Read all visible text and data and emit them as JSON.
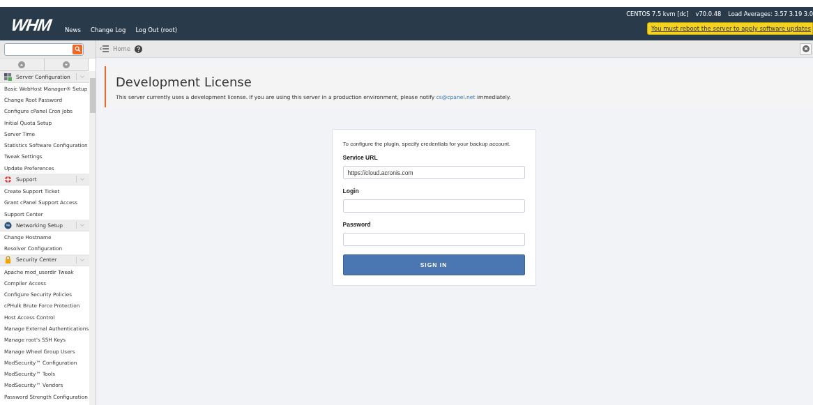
{
  "header": {
    "logo": "WHM",
    "nav": [
      "News",
      "Change Log",
      "Log Out (root)"
    ],
    "server_info": [
      "CENTOS 7.5 kvm [dc]",
      "v70.0.48",
      "Load Averages: 3.57 3.19 3.0"
    ],
    "alert": "You must reboot the server to apply software updates"
  },
  "toolbar": {
    "breadcrumb": "Home"
  },
  "sidebar": {
    "groups": [
      {
        "title": "Server Configuration",
        "items": [
          "Basic WebHost Manager® Setup",
          "Change Root Password",
          "Configure cPanel Cron Jobs",
          "Initial Quota Setup",
          "Server Time",
          "Statistics Software Configuration",
          "Tweak Settings",
          "Update Preferences"
        ]
      },
      {
        "title": "Support",
        "items": [
          "Create Support Ticket",
          "Grant cPanel Support Access",
          "Support Center"
        ]
      },
      {
        "title": "Networking Setup",
        "items": [
          "Change Hostname",
          "Resolver Configuration"
        ]
      },
      {
        "title": "Security Center",
        "items": [
          "Apache mod_userdir Tweak",
          "Compiler Access",
          "Configure Security Policies",
          "cPHulk Brute Force Protection",
          "Host Access Control",
          "Manage External Authentications",
          "Manage root's SSH Keys",
          "Manage Wheel Group Users",
          "ModSecurity™ Configuration",
          "ModSecurity™ Tools",
          "ModSecurity™ Vendors",
          "Password Strength Configuration"
        ]
      }
    ]
  },
  "notice": {
    "title": "Development License",
    "text_before": "This server currently uses a development license. If you are using this server in a production environment, please notify",
    "link": "cs@cpanel.net",
    "text_after": "immediately."
  },
  "form": {
    "intro": "To configure the plugin, specify credentials for your backup account.",
    "fields": [
      {
        "label": "Service URL",
        "value": "https://cloud.acronis.com"
      },
      {
        "label": "Login"
      },
      {
        "label": "Password"
      }
    ],
    "button": "SIGN IN"
  }
}
